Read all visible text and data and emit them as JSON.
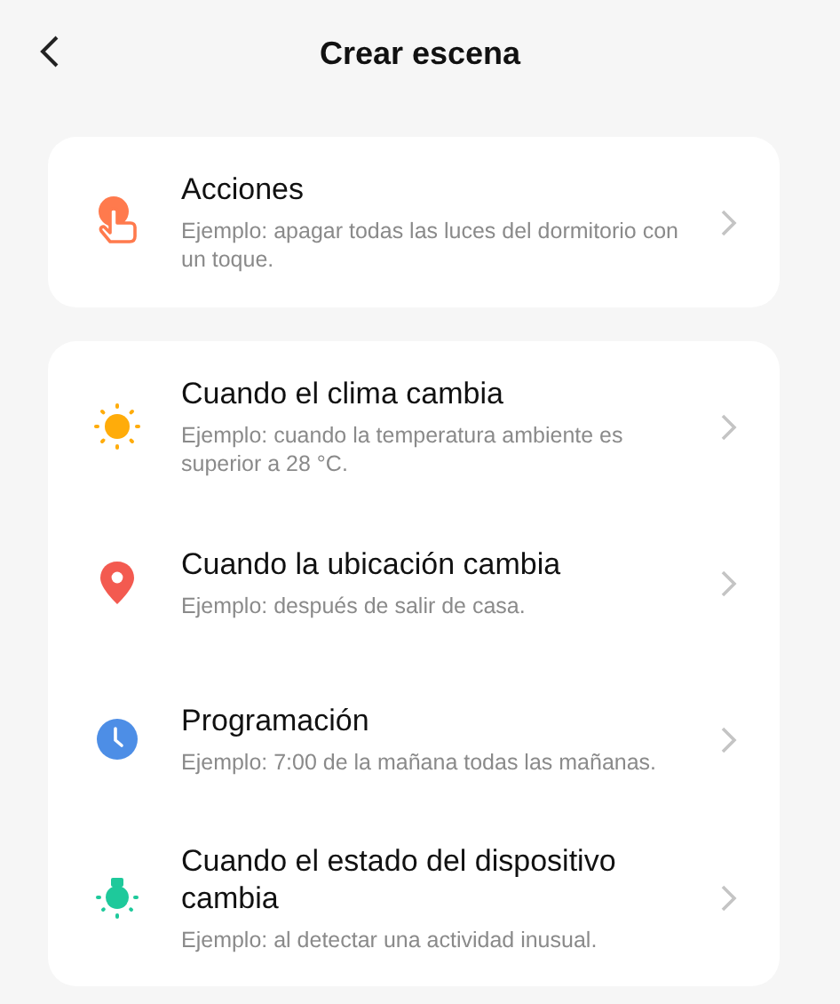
{
  "header": {
    "title": "Crear escena"
  },
  "groups": [
    {
      "items": [
        {
          "kind": "touch",
          "title": "Acciones",
          "description": "Ejemplo: apagar todas las luces del dormitorio con un toque."
        }
      ]
    },
    {
      "items": [
        {
          "kind": "weather",
          "title": "Cuando el clima cambia",
          "description": "Ejemplo: cuando la temperatura ambiente es superior a 28 °C."
        },
        {
          "kind": "location",
          "title": "Cuando la ubicación cambia",
          "description": "Ejemplo: después de salir de casa."
        },
        {
          "kind": "schedule",
          "title": "Programación",
          "description": "Ejemplo: 7:00 de la mañana todas las mañanas."
        },
        {
          "kind": "device",
          "title": "Cuando el estado del dispositivo cambia",
          "description": "Ejemplo: al detectar una actividad inusual."
        }
      ]
    }
  ]
}
